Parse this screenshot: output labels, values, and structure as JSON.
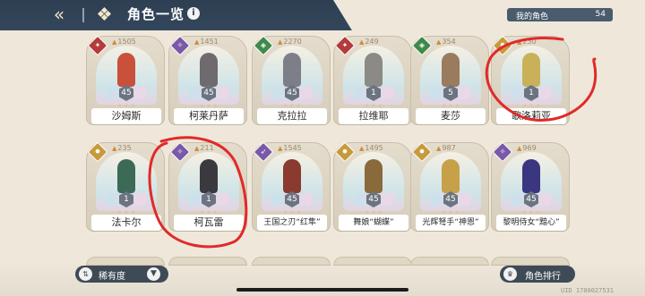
{
  "header": {
    "back_icon": "back-arrow-icon",
    "menu_icon": "four-diamond-menu-icon",
    "title": "角色一览",
    "info_label": "i",
    "my_characters_label": "我的角色",
    "my_characters_count": "54"
  },
  "characters_row1": [
    {
      "name": "沙姆斯",
      "power": "1505",
      "level": "45",
      "class_color": "#b33b3b",
      "class_icon": "sword-icon",
      "class_glyph": "✦",
      "figure_color": "#c9503a"
    },
    {
      "name": "柯莱丹萨",
      "power": "1451",
      "level": "45",
      "class_color": "#7a5aa8",
      "class_icon": "staff-icon",
      "class_glyph": "✧",
      "figure_color": "#6f6a6e"
    },
    {
      "name": "克拉拉",
      "power": "2270",
      "level": "45",
      "class_color": "#3f8a4b",
      "class_icon": "shield-icon",
      "class_glyph": "◈",
      "figure_color": "#7d7f88"
    },
    {
      "name": "拉维耶",
      "power": "249",
      "level": "1",
      "class_color": "#b33b3b",
      "class_icon": "sword-icon",
      "class_glyph": "✦",
      "figure_color": "#8c8a86"
    },
    {
      "name": "麦莎",
      "power": "354",
      "level": "5",
      "class_color": "#3f8a4b",
      "class_icon": "shield-icon",
      "class_glyph": "◈",
      "figure_color": "#9a7b5e"
    },
    {
      "name": "歌洛莉亚",
      "power": "230",
      "level": "1",
      "class_color": "#c79a3c",
      "class_icon": "star-icon",
      "class_glyph": "✸",
      "figure_color": "#c9b15a"
    }
  ],
  "characters_row2": [
    {
      "name": "法卡尔",
      "power": "235",
      "level": "1",
      "class_color": "#c79a3c",
      "class_icon": "star-icon",
      "class_glyph": "✸",
      "figure_color": "#3d6a57"
    },
    {
      "name": "柯瓦雷",
      "power": "211",
      "level": "1",
      "class_color": "#7a5aa8",
      "class_icon": "staff-icon",
      "class_glyph": "✧",
      "figure_color": "#3a3a3e"
    },
    {
      "name": "王国之刃“红隼”",
      "power": "1545",
      "level": "45",
      "class_color": "#7a5aa8",
      "class_icon": "bow-icon",
      "class_glyph": "➶",
      "figure_color": "#8a3a2e"
    },
    {
      "name": "舞娘“蝴蝶”",
      "power": "1495",
      "level": "45",
      "class_color": "#c79a3c",
      "class_icon": "star-icon",
      "class_glyph": "✸",
      "figure_color": "#8a6a3a"
    },
    {
      "name": "光辉弩手“神恩”",
      "power": "987",
      "level": "45",
      "class_color": "#c79a3c",
      "class_icon": "star-icon",
      "class_glyph": "✸",
      "figure_color": "#c7a04a"
    },
    {
      "name": "黎明侍女“黯心”",
      "power": "969",
      "level": "45",
      "class_color": "#7a5aa8",
      "class_icon": "staff-icon",
      "class_glyph": "✧",
      "figure_color": "#3b3680"
    }
  ],
  "footer": {
    "rarity_label": "稀有度",
    "rarity_icon": "rarity-sort-icon",
    "filter_icon": "filter-icon",
    "rank_label": "角色排行",
    "rank_icon": "ranking-icon",
    "uid": "UID 1780027531"
  }
}
